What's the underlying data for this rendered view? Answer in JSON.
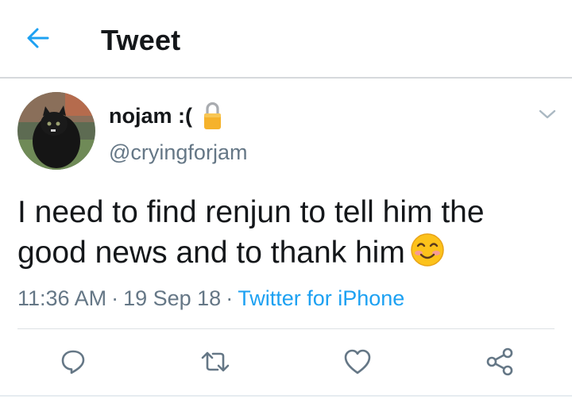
{
  "header": {
    "title": "Tweet"
  },
  "tweet": {
    "display_name": "nojam :(",
    "handle": "@cryingforjam",
    "text": "I need to find renjun to tell him the good news and to thank him",
    "time": "11:36 AM",
    "date": "19 Sep 18",
    "separator": "·",
    "source": "Twitter for iPhone"
  },
  "icons": {
    "back": "arrow-left-icon",
    "lock": "lock-icon",
    "caret": "chevron-down-icon",
    "emoji": "smiling-face-emoji",
    "reply": "reply-icon",
    "retweet": "retweet-icon",
    "like": "heart-icon",
    "share": "share-icon"
  },
  "colors": {
    "accent": "#1da1f2",
    "text": "#14171a",
    "secondary": "#657786",
    "icon": "#657786"
  }
}
